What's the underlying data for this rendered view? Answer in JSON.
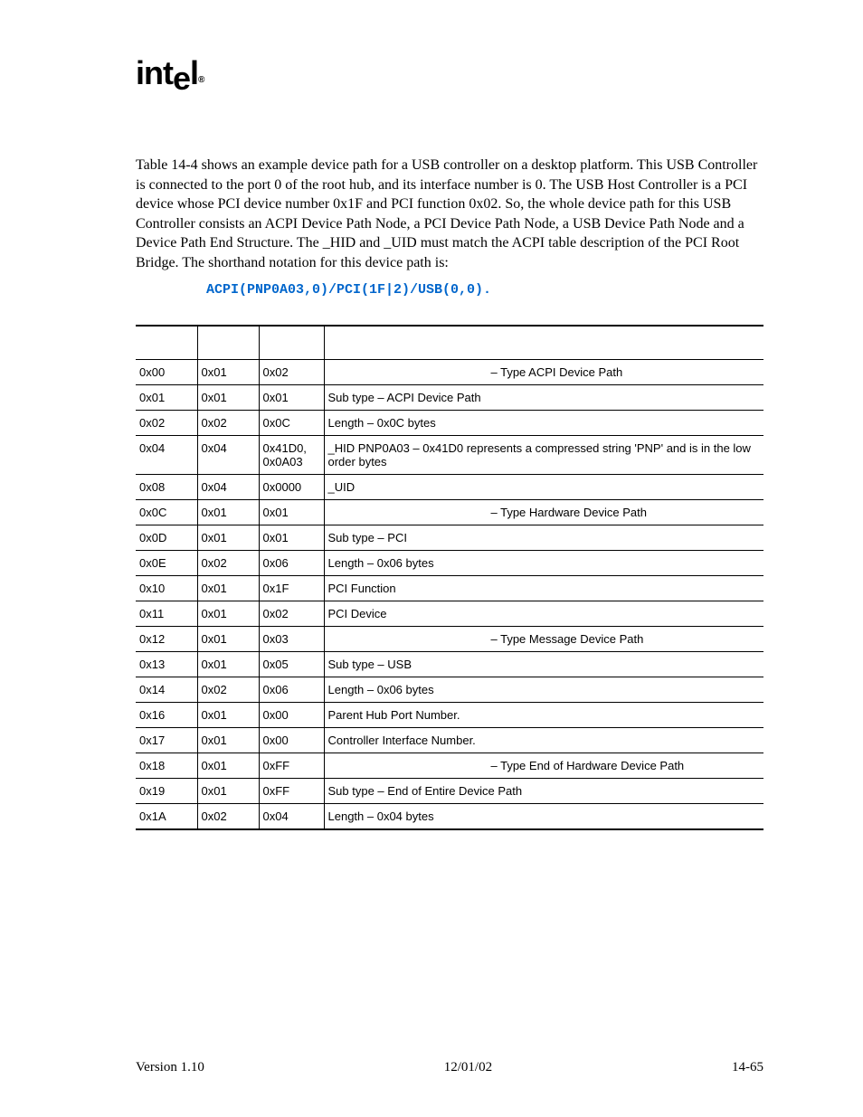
{
  "logo": "intel",
  "paragraph": "Table 14-4 shows an example device path for a USB controller on a desktop platform.  This USB Controller is connected to the port 0 of the root hub, and its interface number is 0.  The USB Host Controller is a PCI device whose PCI device number 0x1F and PCI function 0x02.  So, the whole device path for this USB Controller consists an ACPI Device Path Node, a PCI Device Path Node, a USB Device Path Node and a Device Path End Structure.  The _HID and _UID must match the ACPI table description of the PCI Root Bridge.  The shorthand notation for this device path is:",
  "code": "ACPI(PNP0A03,0)/PCI(1F|2)/USB(0,0).",
  "table": {
    "headers": [
      "",
      "",
      "",
      ""
    ],
    "rows": [
      {
        "c1": "0x00",
        "c2": "0x01",
        "c3": "0x02",
        "c4": "– Type ACPI Device Path",
        "indent": true
      },
      {
        "c1": "0x01",
        "c2": "0x01",
        "c3": "0x01",
        "c4": "Sub type – ACPI Device Path",
        "indent": false
      },
      {
        "c1": "0x02",
        "c2": "0x02",
        "c3": "0x0C",
        "c4": "Length – 0x0C bytes",
        "indent": false
      },
      {
        "c1": "0x04",
        "c2": "0x04",
        "c3": "0x41D0, 0x0A03",
        "c4": "_HID PNP0A03 – 0x41D0 represents a compressed string 'PNP' and is in the low order bytes",
        "indent": false
      },
      {
        "c1": "0x08",
        "c2": "0x04",
        "c3": "0x0000",
        "c4": "_UID",
        "indent": false
      },
      {
        "c1": "0x0C",
        "c2": "0x01",
        "c3": "0x01",
        "c4": "– Type Hardware Device Path",
        "indent": true
      },
      {
        "c1": "0x0D",
        "c2": "0x01",
        "c3": "0x01",
        "c4": "Sub type – PCI",
        "indent": false
      },
      {
        "c1": "0x0E",
        "c2": "0x02",
        "c3": "0x06",
        "c4": "Length – 0x06 bytes",
        "indent": false
      },
      {
        "c1": "0x10",
        "c2": "0x01",
        "c3": "0x1F",
        "c4": "PCI Function",
        "indent": false
      },
      {
        "c1": "0x11",
        "c2": "0x01",
        "c3": "0x02",
        "c4": "PCI Device",
        "indent": false
      },
      {
        "c1": "0x12",
        "c2": "0x01",
        "c3": "0x03",
        "c4": "– Type Message Device Path",
        "indent": true
      },
      {
        "c1": "0x13",
        "c2": "0x01",
        "c3": "0x05",
        "c4": "Sub type – USB",
        "indent": false
      },
      {
        "c1": "0x14",
        "c2": "0x02",
        "c3": "0x06",
        "c4": "Length – 0x06 bytes",
        "indent": false
      },
      {
        "c1": "0x16",
        "c2": "0x01",
        "c3": "0x00",
        "c4": "Parent Hub Port Number.",
        "indent": false
      },
      {
        "c1": "0x17",
        "c2": "0x01",
        "c3": "0x00",
        "c4": "Controller Interface Number.",
        "indent": false
      },
      {
        "c1": "0x18",
        "c2": "0x01",
        "c3": "0xFF",
        "c4": "– Type End of Hardware Device Path",
        "indent": true
      },
      {
        "c1": "0x19",
        "c2": "0x01",
        "c3": "0xFF",
        "c4": "Sub type – End of Entire Device Path",
        "indent": false
      },
      {
        "c1": "0x1A",
        "c2": "0x02",
        "c3": "0x04",
        "c4": "Length – 0x04 bytes",
        "indent": false
      }
    ]
  },
  "footer": {
    "left": "Version 1.10",
    "center": "12/01/02",
    "right": "14-65"
  }
}
